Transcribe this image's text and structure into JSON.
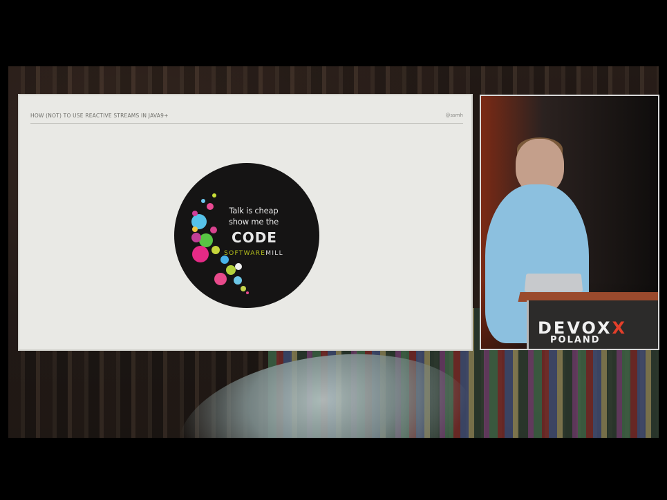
{
  "slide": {
    "title": "HOW (NOT) TO USE REACTIVE STREAMS IN JAVA9+",
    "handle": "@ssmh",
    "badge": {
      "line1": "Talk is cheap",
      "line2": "show me the",
      "code": "CODE",
      "brand_part1": "SOFTWARE",
      "brand_part2": "MILL"
    }
  },
  "camera": {
    "logo_main": "DEVOX",
    "logo_x": "X",
    "logo_sub": "POLAND"
  }
}
